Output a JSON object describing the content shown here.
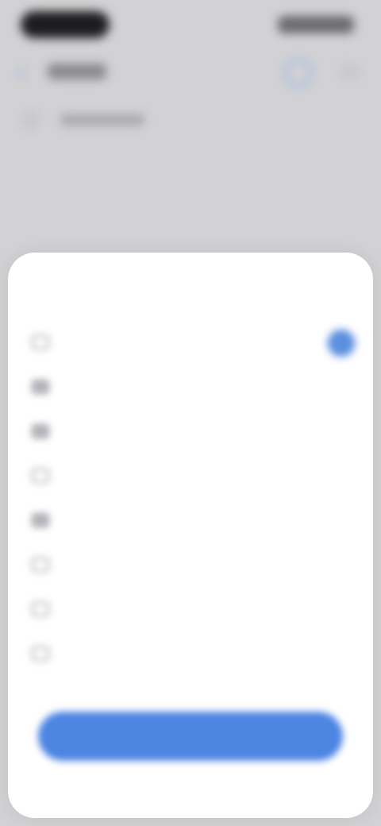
{
  "background_app": {
    "back_icon": "chevron-left-icon",
    "back_glyph": "‹",
    "action_icon": "circle-icon",
    "subheader_icon": "circle-icon"
  },
  "sheet": {
    "title": "",
    "options": [
      {
        "label": "",
        "icon": "square-outline-icon",
        "selected": true
      },
      {
        "label": "",
        "icon": "square-filled-icon",
        "selected": false
      },
      {
        "label": "",
        "icon": "square-filled-icon",
        "selected": false
      },
      {
        "label": "",
        "icon": "square-outline-icon",
        "selected": false
      },
      {
        "label": "",
        "icon": "square-filled-icon",
        "selected": false
      },
      {
        "label": "",
        "icon": "square-outline-icon",
        "selected": false
      },
      {
        "label": "",
        "icon": "square-outline-icon",
        "selected": false
      },
      {
        "label": "",
        "icon": "square-outline-icon",
        "selected": false
      }
    ],
    "confirm_label": ""
  },
  "colors": {
    "accent": "#4d85e3",
    "backdrop": "#d2d2d4",
    "sheet_bg": "#ffffff"
  }
}
